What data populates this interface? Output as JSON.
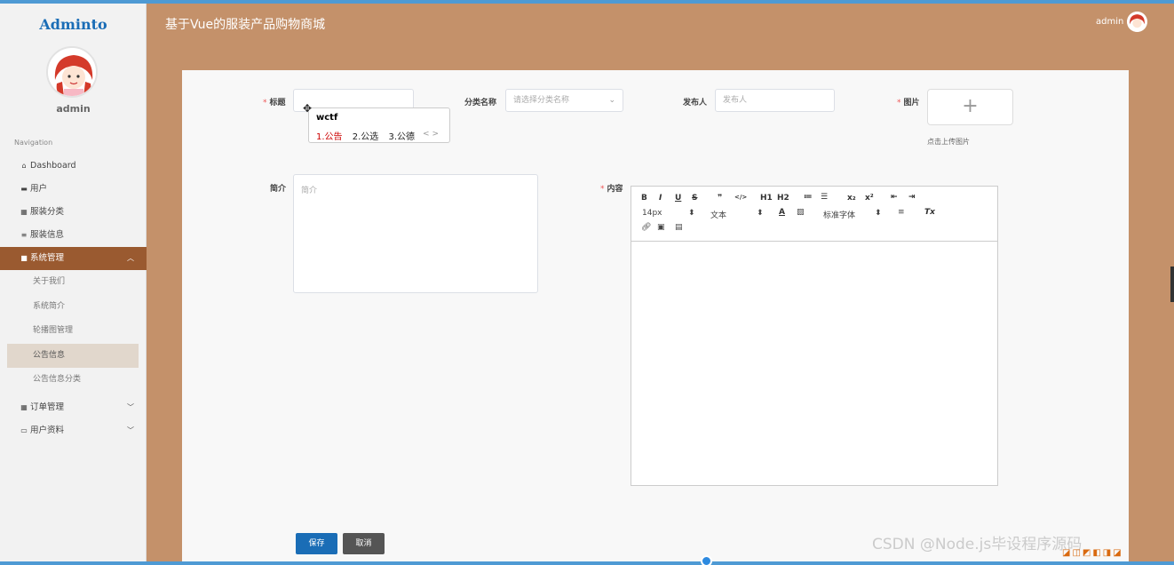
{
  "app": {
    "title": "基于Vue的服装产品购物商城",
    "logo": "Adminto",
    "user": "admin"
  },
  "sidebar": {
    "username": "admin",
    "nav_heading": "Navigation",
    "items": [
      {
        "label": "Dashboard",
        "icon": "home-icon"
      },
      {
        "label": "用户",
        "icon": "user-icon"
      },
      {
        "label": "服装分类",
        "icon": "grid-icon"
      },
      {
        "label": "服装信息",
        "icon": "list-icon"
      },
      {
        "label": "系统管理",
        "icon": "video-icon",
        "expanded": true
      },
      {
        "label": "订单管理",
        "icon": "grid-icon"
      },
      {
        "label": "用户资料",
        "icon": "id-card-icon"
      }
    ],
    "sub_items": [
      "关于我们",
      "系统简介",
      "轮播图管理",
      "公告信息",
      "公告信息分类"
    ],
    "selected_sub": "公告信息"
  },
  "form": {
    "title_label": "标题",
    "category_label": "分类名称",
    "category_placeholder": "请选择分类名称",
    "publisher_label": "发布人",
    "publisher_placeholder": "发布人",
    "image_label": "图片",
    "upload_plus": "+",
    "upload_hint": "点击上传图片",
    "intro_label": "简介",
    "intro_placeholder": "简介",
    "content_label": "内容",
    "save_label": "保存",
    "cancel_label": "取消"
  },
  "ime": {
    "typed": "wctf",
    "candidates": [
      "1.公告",
      "2.公选",
      "3.公德"
    ],
    "nav": "< >"
  },
  "editor": {
    "row1": [
      "B",
      "I",
      "U",
      "S",
      "❞",
      "</>",
      "H1",
      "H2",
      "≔",
      "☰",
      "x₂",
      "x²",
      "⇤",
      "⇥"
    ],
    "font_size": "14px",
    "text_style": "文本",
    "font_family": "标准字体",
    "clear_format": "Tx"
  },
  "watermark": "CSDN @Node.js毕设程序源码"
}
